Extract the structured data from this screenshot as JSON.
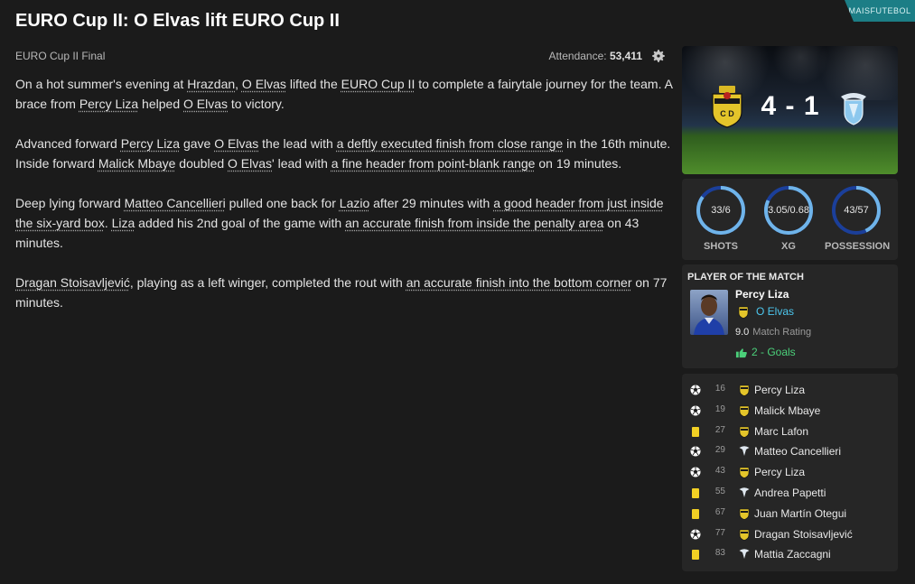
{
  "header": {
    "headline": "EURO Cup II: O Elvas lift EURO Cup II",
    "brand": "MAISFUTEBOL",
    "competition_stage": "EURO Cup II Final",
    "attendance_label": "Attendance:",
    "attendance_value": "53,411"
  },
  "story": {
    "p1": [
      "On a hot summer's evening at ",
      "Hrazdan",
      ", ",
      "O Elvas",
      " lifted the ",
      "EURO Cup II",
      " to complete a fairytale journey for the team. A brace from ",
      "Percy Liza",
      " helped ",
      "O Elvas",
      " to victory."
    ],
    "p2": [
      "Advanced forward ",
      "Percy Liza",
      " gave ",
      "O Elvas",
      " the lead with ",
      "a deftly executed finish from close range",
      " in the 16th minute. Inside forward ",
      "Malick Mbaye",
      " doubled ",
      "O Elvas",
      "' lead with ",
      "a fine header from point-blank range",
      " on 19 minutes."
    ],
    "p3": [
      "Deep lying forward ",
      "Matteo Cancellieri",
      " pulled one back for ",
      "Lazio",
      " after 29 minutes with ",
      "a good header from just inside the six-yard box",
      ". ",
      "Liza",
      " added his 2nd goal of the game with ",
      "an accurate finish from inside the penalty area",
      " on 43 minutes."
    ],
    "p4": [
      "Dragan Stoisavljević",
      ", playing as a left winger, completed the rout with ",
      "an accurate finish into the bottom corner",
      " on 77 minutes."
    ]
  },
  "scoreboard": {
    "score": "4 - 1"
  },
  "stats": [
    {
      "label": "SHOTS",
      "value": "33/6",
      "home_share": 0.85
    },
    {
      "label": "XG",
      "value": "3.05/0.68",
      "home_share": 0.82
    },
    {
      "label": "POSSESSION",
      "value": "43/57",
      "home_share": 0.43
    }
  ],
  "potm": {
    "title": "PLAYER OF THE MATCH",
    "name": "Percy Liza",
    "club": "O Elvas",
    "rating": "9.0",
    "rating_label": "Match Rating",
    "goals": "2 - Goals"
  },
  "events": [
    {
      "type": "goal",
      "minute": "16",
      "team": "home",
      "player": "Percy Liza"
    },
    {
      "type": "goal",
      "minute": "19",
      "team": "home",
      "player": "Malick Mbaye"
    },
    {
      "type": "yellow",
      "minute": "27",
      "team": "home",
      "player": "Marc Lafon"
    },
    {
      "type": "goal",
      "minute": "29",
      "team": "away",
      "player": "Matteo Cancellieri"
    },
    {
      "type": "goal",
      "minute": "43",
      "team": "home",
      "player": "Percy Liza"
    },
    {
      "type": "yellow",
      "minute": "55",
      "team": "away",
      "player": "Andrea Papetti"
    },
    {
      "type": "yellow",
      "minute": "67",
      "team": "home",
      "player": "Juan Martín Otegui"
    },
    {
      "type": "goal",
      "minute": "77",
      "team": "home",
      "player": "Dragan Stoisavljević"
    },
    {
      "type": "yellow",
      "minute": "83",
      "team": "away",
      "player": "Mattia Zaccagni"
    }
  ],
  "colors": {
    "ring_home": "#6fb4ea",
    "ring_away": "#1b3f9a",
    "link": "#4cc7ee",
    "goal_green": "#4bd07a",
    "yellow_card": "#f2d024",
    "brand_bg": "#1c7e86"
  },
  "icons": {
    "attendance": "gear-icon",
    "goal": "football-icon",
    "yellow": "yellow-card-icon",
    "thumb": "thumbs-up-icon"
  }
}
